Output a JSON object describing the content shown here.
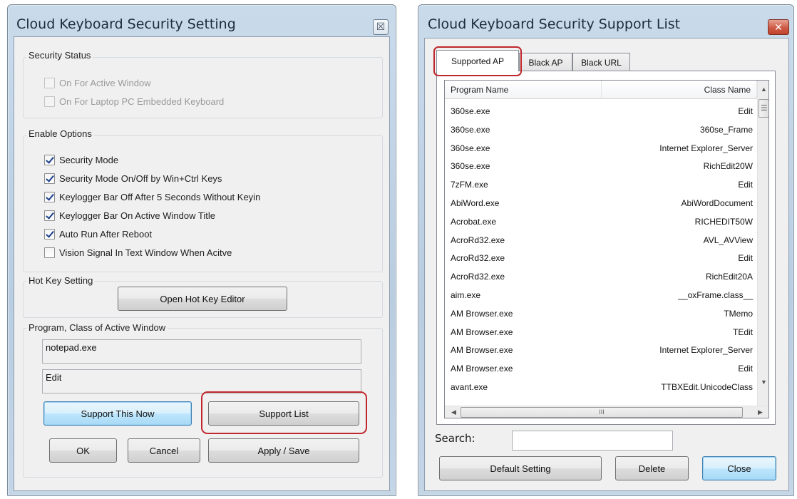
{
  "settings_window": {
    "title": "Cloud Keyboard Security Setting",
    "close_glyph": "☒",
    "security_status": {
      "label": "Security Status",
      "options": [
        {
          "label": "On For Active Window",
          "checked": false
        },
        {
          "label": "On For Laptop PC Embedded Keyboard",
          "checked": false
        }
      ]
    },
    "enable_options": {
      "label": "Enable Options",
      "options": [
        {
          "label": "Security Mode",
          "checked": true
        },
        {
          "label": "Security Mode On/Off by Win+Ctrl Keys",
          "checked": true
        },
        {
          "label": "Keylogger Bar Off After 5 Seconds Without Keyin",
          "checked": true
        },
        {
          "label": "Keylogger Bar On Active Window Title",
          "checked": true
        },
        {
          "label": "Auto Run After Reboot",
          "checked": true
        },
        {
          "label": "Vision Signal In Text Window When Acitve",
          "checked": false
        }
      ]
    },
    "hotkey": {
      "label": "Hot Key Setting",
      "button": "Open Hot Key Editor"
    },
    "active_window": {
      "label": "Program, Class of Active Window",
      "program": "notepad.exe",
      "class": "Edit"
    },
    "buttons": {
      "support_now": "Support This Now",
      "support_list": "Support List",
      "ok": "OK",
      "cancel": "Cancel",
      "apply_save": "Apply / Save"
    }
  },
  "list_window": {
    "title": "Cloud Keyboard Security Support List",
    "close_glyph": "✕",
    "tabs": [
      "Supported AP",
      "Black AP",
      "Black URL"
    ],
    "columns": [
      "Program Name",
      "Class Name"
    ],
    "rows": [
      [
        "360se.exe",
        "Edit"
      ],
      [
        "360se.exe",
        "360se_Frame"
      ],
      [
        "360se.exe",
        "Internet Explorer_Server"
      ],
      [
        "360se.exe",
        "RichEdit20W"
      ],
      [
        "7zFM.exe",
        "Edit"
      ],
      [
        "AbiWord.exe",
        "AbiWordDocument"
      ],
      [
        "Acrobat.exe",
        "RICHEDIT50W"
      ],
      [
        "AcroRd32.exe",
        "AVL_AVView"
      ],
      [
        "AcroRd32.exe",
        "Edit"
      ],
      [
        "AcroRd32.exe",
        "RichEdit20A"
      ],
      [
        "aim.exe",
        "__oxFrame.class__"
      ],
      [
        "AM Browser.exe",
        "TMemo"
      ],
      [
        "AM Browser.exe",
        "TEdit"
      ],
      [
        "AM Browser.exe",
        "Internet Explorer_Server"
      ],
      [
        "AM Browser.exe",
        "Edit"
      ],
      [
        "avant.exe",
        "TTBXEdit.UnicodeClass"
      ]
    ],
    "scroll_glyphs": {
      "up": "▲",
      "down": "▼",
      "left": "◀",
      "right": "▶",
      "grip_v": "☰",
      "grip_h": "III"
    },
    "search_label": "Search:",
    "search_value": "",
    "buttons": {
      "default_setting": "Default Setting",
      "delete": "Delete",
      "close": "Close"
    }
  }
}
